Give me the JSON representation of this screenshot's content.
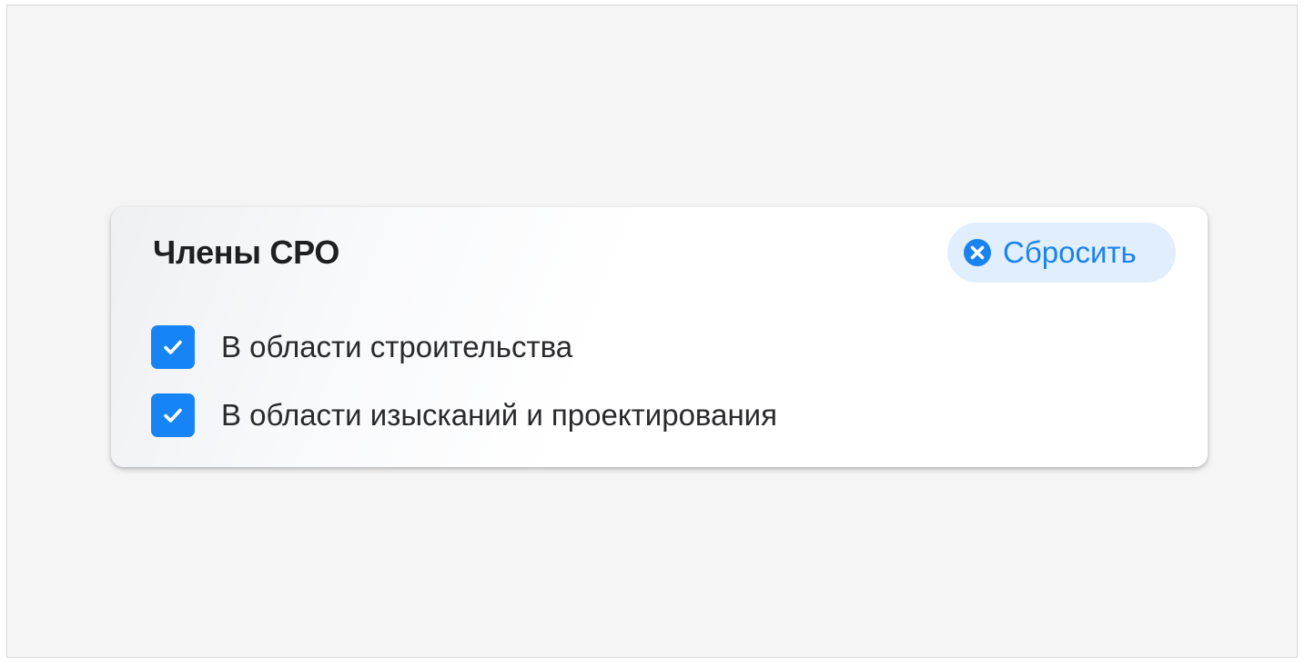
{
  "filter": {
    "title": "Члены СРО",
    "reset_label": "Сбросить",
    "reset_icon": "close-circle-icon",
    "options": [
      {
        "label": "В области строительства",
        "checked": true
      },
      {
        "label": "В области изысканий и проектирования",
        "checked": true
      }
    ]
  },
  "colors": {
    "accent": "#1684f5",
    "reset_background": "#e0eefd",
    "reset_text": "#1a83f0",
    "page_background": "#f5f5f6"
  }
}
